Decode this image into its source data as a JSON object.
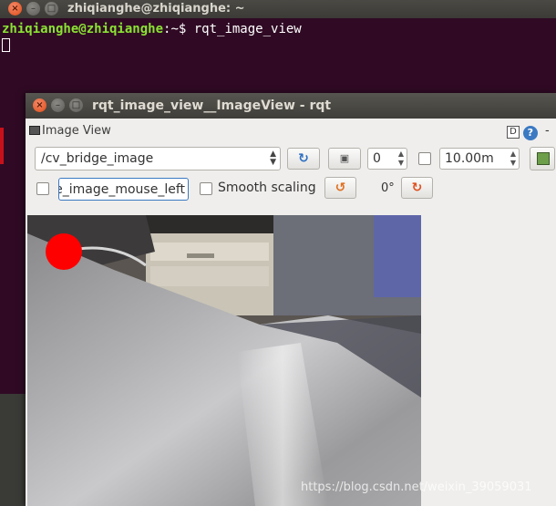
{
  "terminal": {
    "title": "zhiqianghe@zhiqianghe: ~",
    "prompt_user": "zhiqianghe@zhiqianghe",
    "prompt_rest": ":~$ ",
    "command": "rqt_image_view"
  },
  "rqt": {
    "title": "rqt_image_view__ImageView - rqt",
    "dock_title": "Image View",
    "dock_d_label": "D",
    "help_label": "?",
    "dock_dash": "-",
    "topic": "/cv_bridge_image",
    "refresh_icon": "refresh-icon",
    "zoom_value": "0",
    "rate_value": "10.00m",
    "mouse_topic": "/cv_bridge_image_mouse_left",
    "smooth_label": "Smooth scaling",
    "rotation_label": "0°"
  },
  "watermark": "https://blog.csdn.net/weixin_39059031",
  "colors": {
    "terminal_bg": "#300a24",
    "prompt_green": "#8ae234",
    "close_button": "#df4b16",
    "mouse_marker": "#ff0000"
  }
}
